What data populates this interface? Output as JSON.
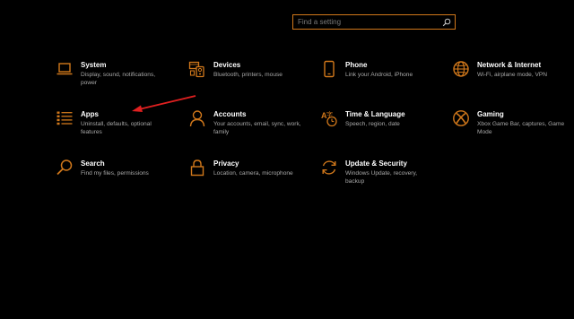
{
  "search": {
    "placeholder": "Find a setting"
  },
  "categories": [
    {
      "title": "System",
      "description": "Display, sound, notifications, power",
      "icon": "laptop-icon"
    },
    {
      "title": "Devices",
      "description": "Bluetooth, printers, mouse",
      "icon": "devices-icon"
    },
    {
      "title": "Phone",
      "description": "Link your Android, iPhone",
      "icon": "phone-icon"
    },
    {
      "title": "Network & Internet",
      "description": "Wi-Fi, airplane mode, VPN",
      "icon": "globe-icon"
    },
    {
      "title": "Apps",
      "description": "Uninstall, defaults, optional features",
      "icon": "apps-list-icon"
    },
    {
      "title": "Accounts",
      "description": "Your accounts, email, sync, work, family",
      "icon": "person-icon"
    },
    {
      "title": "Time & Language",
      "description": "Speech, region, date",
      "icon": "time-language-icon"
    },
    {
      "title": "Gaming",
      "description": "Xbox Game Bar, captures, Game Mode",
      "icon": "xbox-icon"
    },
    {
      "title": "Search",
      "description": "Find my files, permissions",
      "icon": "magnifier-icon"
    },
    {
      "title": "Privacy",
      "description": "Location, camera, microphone",
      "icon": "lock-icon"
    },
    {
      "title": "Update & Security",
      "description": "Windows Update, recovery, backup",
      "icon": "update-icon"
    }
  ],
  "colors": {
    "accent": "#d1781b",
    "background": "#000000",
    "title_text": "#ffffff",
    "description_text": "#a8a8a8",
    "annotation_arrow": "#e02020"
  }
}
